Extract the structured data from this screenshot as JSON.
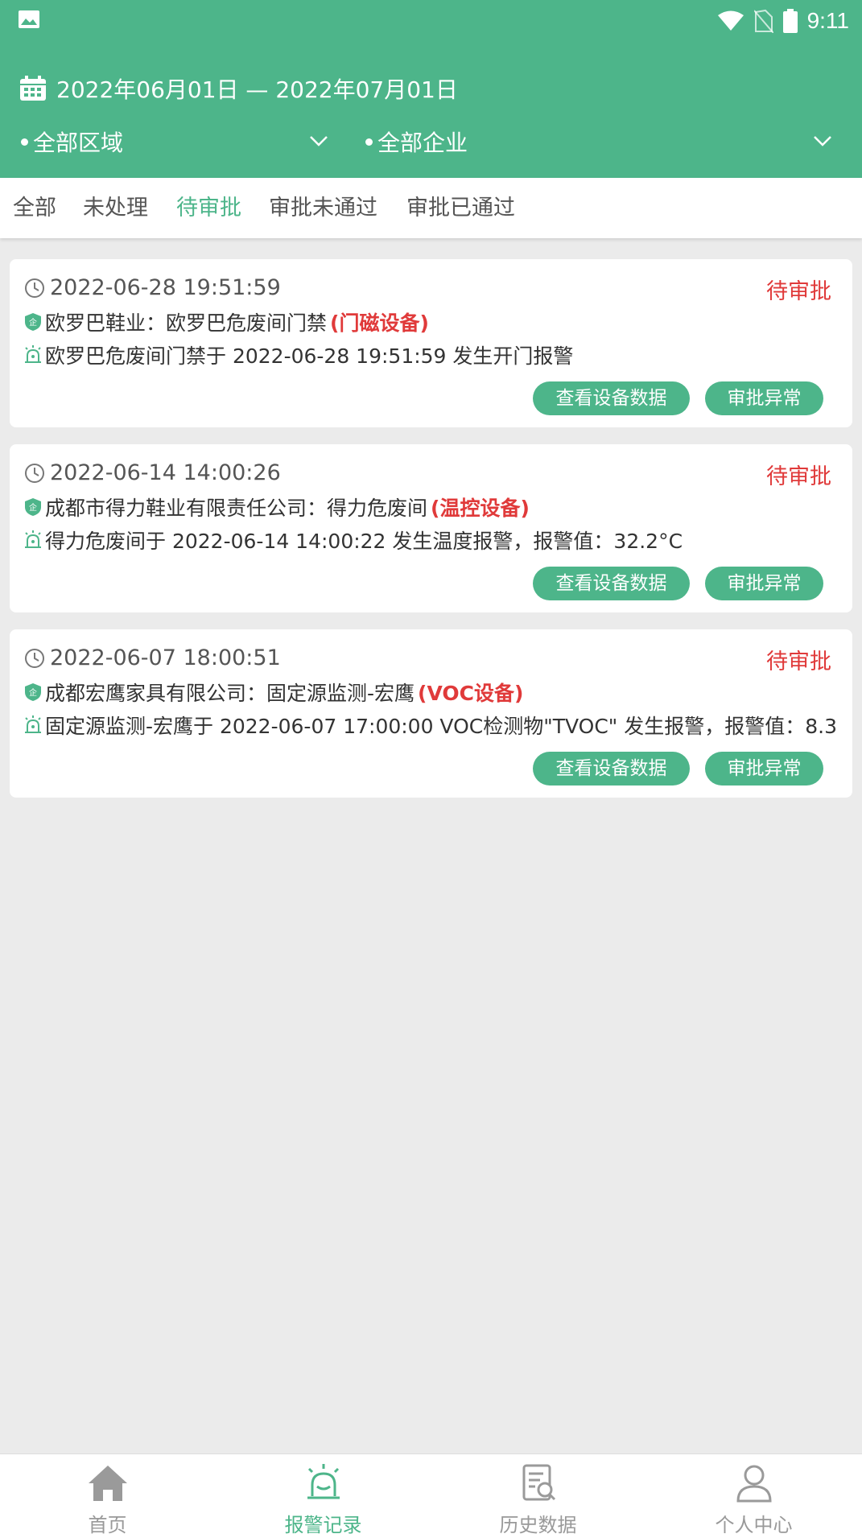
{
  "status_bar": {
    "time": "9:11"
  },
  "header": {
    "date_range": "2022年06月01日 — 2022年07月01日",
    "region_filter": "全部区域",
    "company_filter": "全部企业"
  },
  "tabs": [
    {
      "label": "全部"
    },
    {
      "label": "未处理"
    },
    {
      "label": "待审批"
    },
    {
      "label": "审批未通过"
    },
    {
      "label": "审批已通过"
    }
  ],
  "alerts": [
    {
      "time": "2022-06-28 19:51:59",
      "status": "待审批",
      "source": "欧罗巴鞋业：欧罗巴危废间门禁",
      "device_type": "(门磁设备)",
      "message": "欧罗巴危废间门禁于 2022-06-28 19:51:59 发生开门报警",
      "view_button": "查看设备数据",
      "approve_button": "审批异常"
    },
    {
      "time": "2022-06-14 14:00:26",
      "status": "待审批",
      "source": "成都市得力鞋业有限责任公司：得力危废间",
      "device_type": "(温控设备)",
      "message": "得力危废间于 2022-06-14 14:00:22 发生温度报警，报警值：32.2°C",
      "view_button": "查看设备数据",
      "approve_button": "审批异常"
    },
    {
      "time": "2022-06-07 18:00:51",
      "status": "待审批",
      "source": "成都宏鹰家具有限公司：固定源监测-宏鹰",
      "device_type": "(VOC设备)",
      "message": "固定源监测-宏鹰于 2022-06-07 17:00:00 VOC检测物\"TVOC\" 发生报警，报警值：8.3",
      "view_button": "查看设备数据",
      "approve_button": "审批异常"
    }
  ],
  "bottom_nav": [
    {
      "label": "首页",
      "icon": "home-icon"
    },
    {
      "label": "报警记录",
      "icon": "alarm-icon"
    },
    {
      "label": "历史数据",
      "icon": "history-icon"
    },
    {
      "label": "个人中心",
      "icon": "person-icon"
    }
  ],
  "colors": {
    "primary": "#4db58a",
    "alert_red": "#e03a3a",
    "background": "#ebebeb"
  }
}
